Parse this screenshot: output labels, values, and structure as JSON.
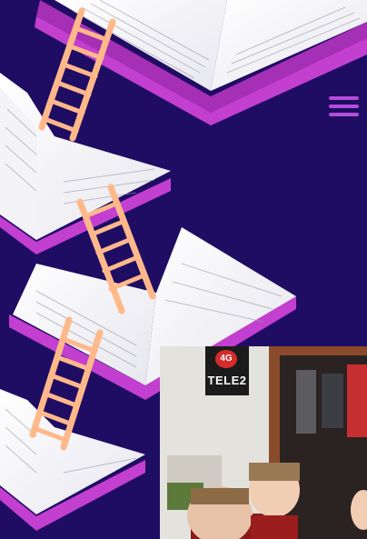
{
  "colors": {
    "background": "#1f0c63",
    "accent": "#b44dd8",
    "book_edge": "#c23fd0",
    "ladder": "#ffc091"
  },
  "header": {
    "menu_icon": "hamburger-menu-icon"
  },
  "illustration": {
    "subject": "books-and-ladders"
  },
  "photo": {
    "sign_badge": "4G",
    "sign_brand": "TELE2"
  }
}
